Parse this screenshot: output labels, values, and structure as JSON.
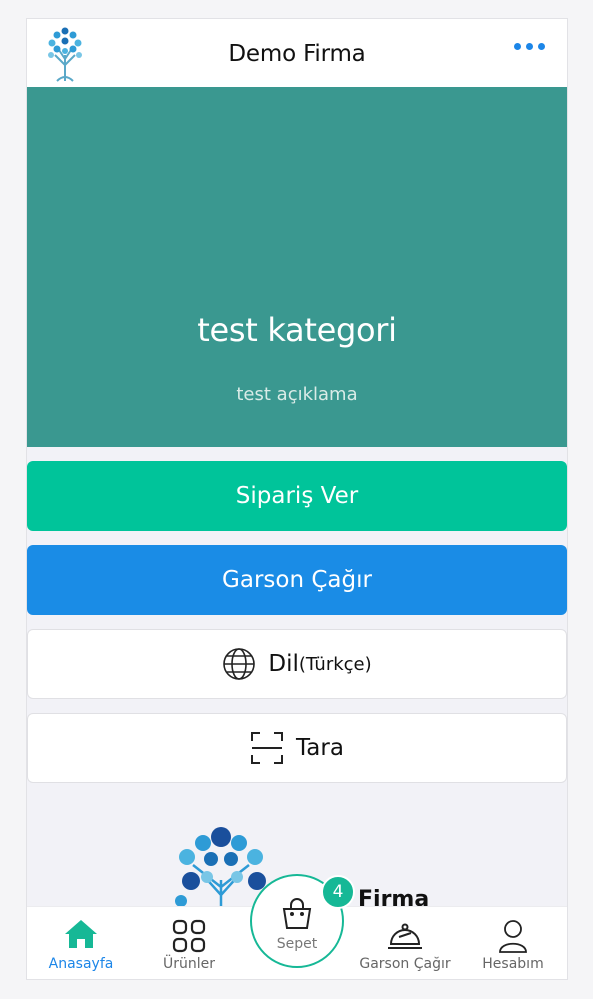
{
  "header": {
    "title": "Demo Firma",
    "menu_icon": "more-dots-icon",
    "accent": "#1c86e8"
  },
  "hero": {
    "title": "test kategori",
    "description": "test açıklama",
    "bg_color": "#3a9890"
  },
  "actions": {
    "order_label": "Sipariş Ver",
    "waiter_label": "Garson Çağır",
    "language_label": "Dil",
    "language_value": "(Türkçe)",
    "scan_label": "Tara",
    "order_color": "#00c49a",
    "waiter_color": "#1a8ce6"
  },
  "brand": {
    "text": "Firma"
  },
  "tabbar": {
    "home_label": "Anasayfa",
    "products_label": "Ürünler",
    "cart_label": "Sepet",
    "cart_count": "4",
    "waiter_label": "Garson Çağır",
    "account_label": "Hesabım",
    "active": "home",
    "active_color": "#16b896"
  }
}
